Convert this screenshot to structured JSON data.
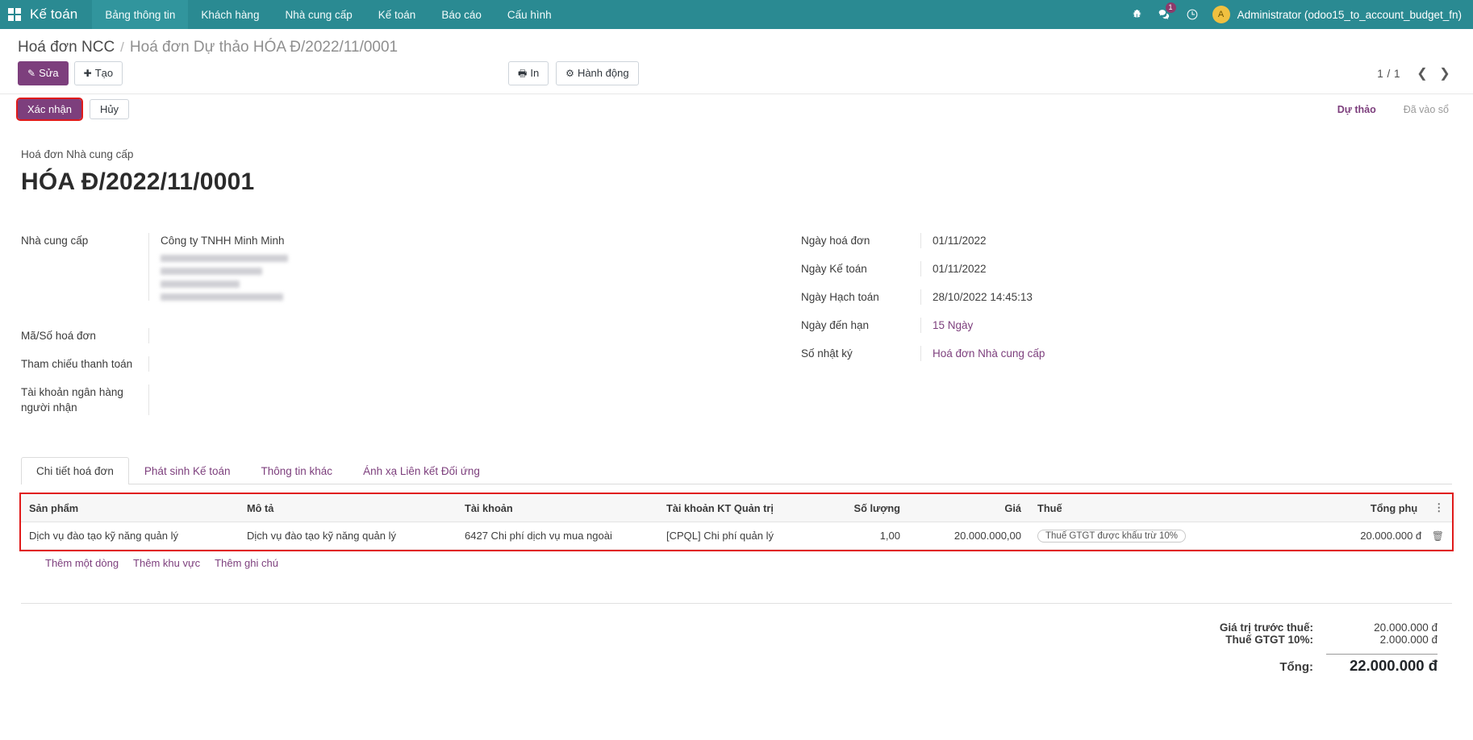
{
  "navbar": {
    "brand": "Kế toán",
    "apps_icon": "apps-grid-icon",
    "menu": [
      {
        "label": "Bảng thông tin",
        "active": true
      },
      {
        "label": "Khách hàng",
        "active": false
      },
      {
        "label": "Nhà cung cấp",
        "active": false
      },
      {
        "label": "Kế toán",
        "active": false
      },
      {
        "label": "Báo cáo",
        "active": false
      },
      {
        "label": "Cấu hình",
        "active": false
      }
    ],
    "messages_badge": "1",
    "user": "Administrator (odoo15_to_account_budget_fn)",
    "avatar_initial": "A",
    "accent_color": "#2a8a92"
  },
  "breadcrumb": {
    "root": "Hoá đơn NCC",
    "separator": "/",
    "current": "Hoá đơn Dự thảo HÓA Đ/2022/11/0001"
  },
  "controlpanel": {
    "edit_label": "Sửa",
    "create_label": "Tạo",
    "print_label": "In",
    "action_label": "Hành động",
    "pager": "1 / 1",
    "prev_icon": "chevron-left-icon",
    "next_icon": "chevron-right-icon"
  },
  "statusbar": {
    "confirm_label": "Xác nhận",
    "cancel_label": "Hủy",
    "stages": [
      {
        "label": "Dự thảo",
        "active": true
      },
      {
        "label": "Đã vào sổ",
        "active": false
      }
    ],
    "highlight_color": "#e01a1a"
  },
  "form": {
    "subtitle": "Hoá đơn Nhà cung cấp",
    "title": "HÓA Đ/2022/11/0001",
    "left_fields": [
      {
        "label": "Nhà cung cấp",
        "value": "Công ty TNHH Minh Minh"
      },
      {
        "label": "Mã/Số hoá đơn",
        "value": ""
      },
      {
        "label": "Tham chiếu thanh toán",
        "value": ""
      },
      {
        "label": "Tài khoản ngân hàng người nhận",
        "value": ""
      }
    ],
    "right_fields": [
      {
        "label": "Ngày hoá đơn",
        "value": "01/11/2022",
        "link": false
      },
      {
        "label": "Ngày Kế toán",
        "value": "01/11/2022",
        "link": false
      },
      {
        "label": "Ngày Hạch toán",
        "value": "28/10/2022 14:45:13",
        "link": false
      },
      {
        "label": "Ngày đến hạn",
        "value": "15 Ngày",
        "link": true
      },
      {
        "label": "Số nhật ký",
        "value": "Hoá đơn Nhà cung cấp",
        "link": true
      }
    ]
  },
  "notebook": {
    "tabs": [
      {
        "label": "Chi tiết hoá đơn",
        "active": true
      },
      {
        "label": "Phát sinh Kế toán",
        "active": false
      },
      {
        "label": "Thông tin khác",
        "active": false
      },
      {
        "label": "Ánh xạ Liên kết Đối ứng",
        "active": false
      }
    ]
  },
  "lines_table": {
    "columns": [
      "Sản phẩm",
      "Mô tả",
      "Tài khoản",
      "Tài khoản KT Quản trị",
      "Số lượng",
      "Giá",
      "Thuế",
      "Tổng phụ"
    ],
    "optional_col_icon": "vertical-dots-icon",
    "rows": [
      {
        "product": "Dịch vụ đào tạo kỹ năng quản lý",
        "description": "Dịch vụ đào tạo kỹ năng quản lý",
        "account": "6427 Chi phí dịch vụ mua ngoài",
        "analytic_account": "[CPQL] Chi phí quản lý",
        "quantity": "1,00",
        "price": "20.000.000,00",
        "tax": "Thuế GTGT được khấu trừ 10%",
        "subtotal": "20.000.000 đ",
        "delete_icon": "trash-icon"
      }
    ],
    "add_links": [
      "Thêm một dòng",
      "Thêm khu vực",
      "Thêm ghi chú"
    ]
  },
  "totals": {
    "untaxed_label": "Giá trị trước thuế:",
    "untaxed_value": "20.000.000 đ",
    "tax_label": "Thuế GTGT 10%:",
    "tax_value": "2.000.000 đ",
    "total_label": "Tổng:",
    "total_value": "22.000.000 đ"
  }
}
